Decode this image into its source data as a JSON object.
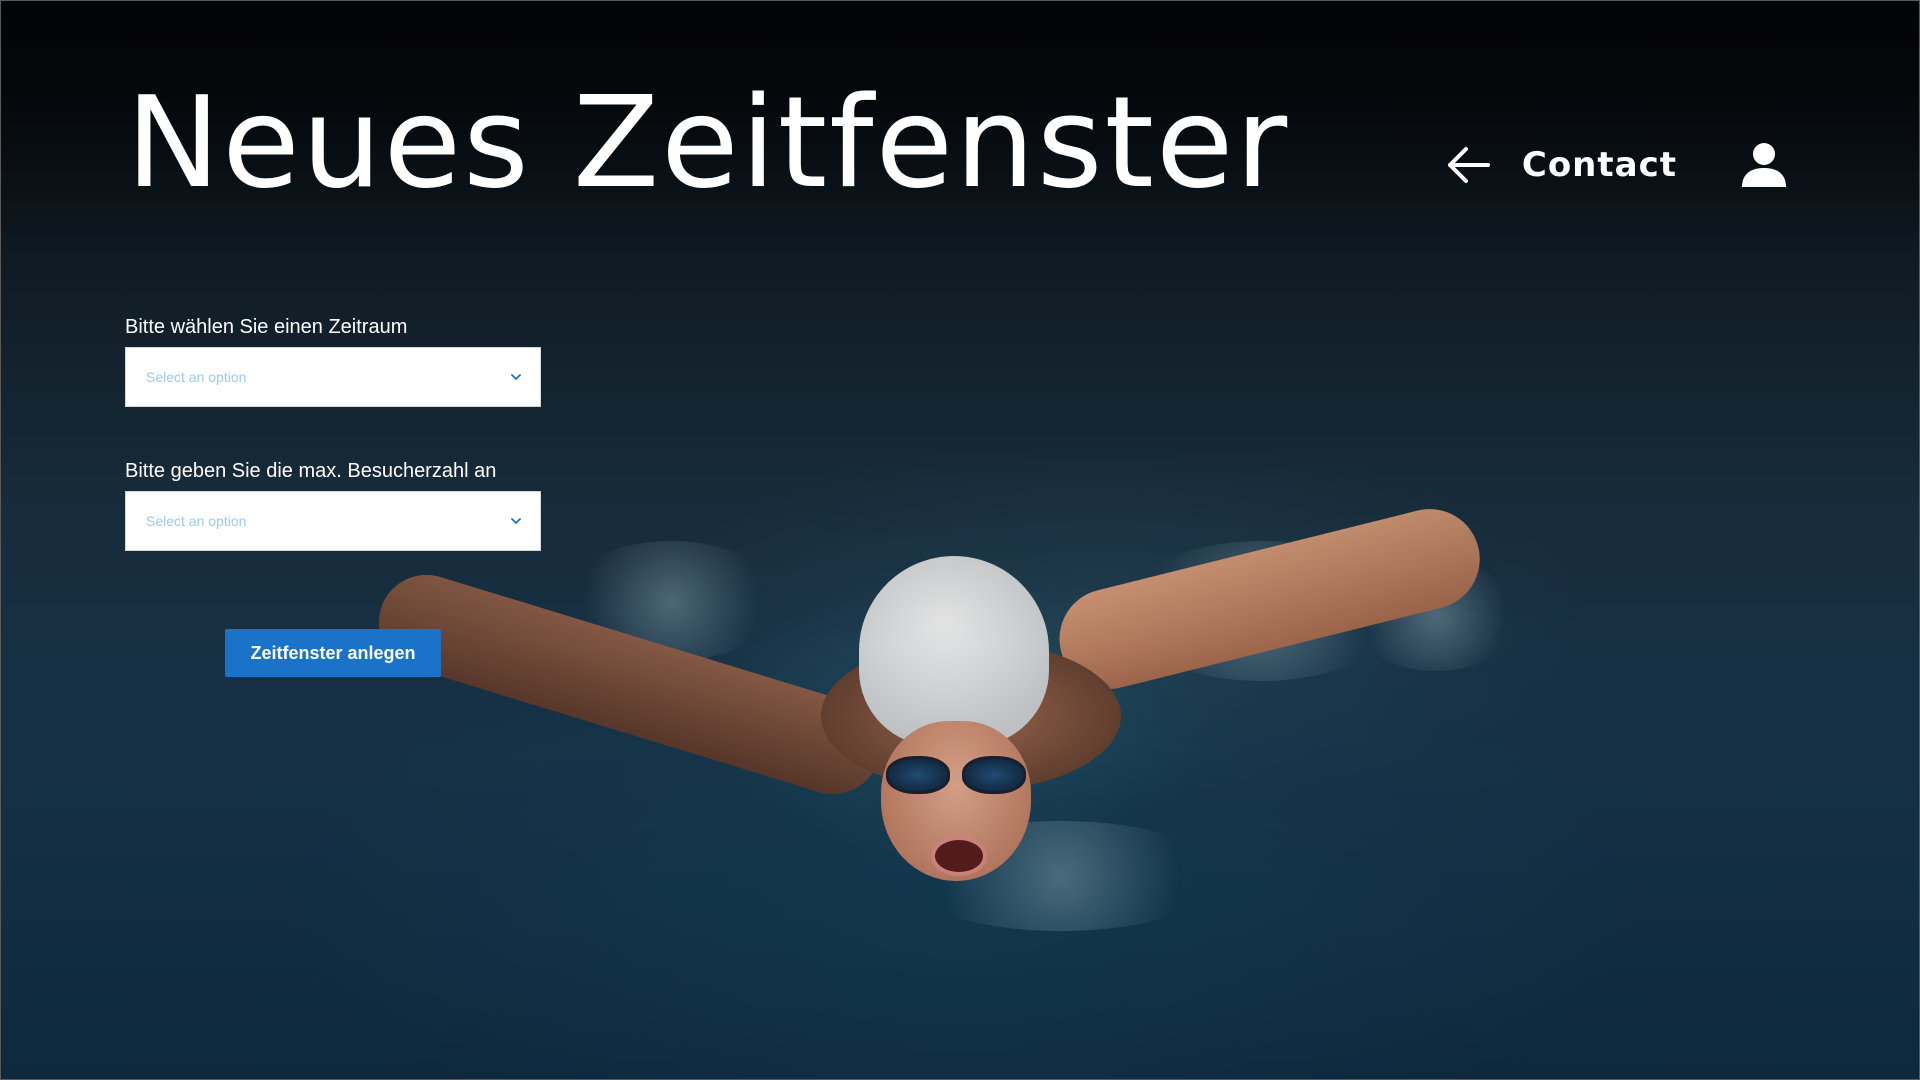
{
  "header": {
    "title": "Neues Zeitfenster",
    "nav": {
      "back_icon": "arrow-left-icon",
      "contact_label": "Contact",
      "user_icon": "user-icon"
    }
  },
  "form": {
    "fields": [
      {
        "label": "Bitte wählen Sie einen Zeitraum",
        "placeholder": "Select an option",
        "icon": "chevron-down-icon"
      },
      {
        "label": "Bitte geben Sie die max. Besucherzahl an",
        "placeholder": "Select an option",
        "icon": "chevron-down-icon"
      }
    ],
    "submit_label": "Zeitfenster anlegen"
  },
  "colors": {
    "accent": "#1a73c9",
    "placeholder": "#9ec7ee",
    "text": "#ffffff"
  },
  "background": {
    "image": "swimmer-butterfly-photo"
  }
}
